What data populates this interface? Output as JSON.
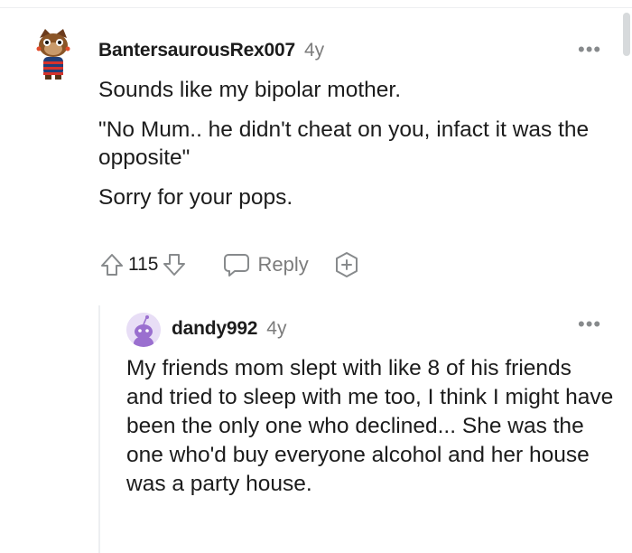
{
  "comment": {
    "username": "BantersaurousRex007",
    "age": "4y",
    "paragraphs": [
      "Sounds like my bipolar mother.",
      "\"No Mum.. he didn't cheat on you, infact it was the opposite\"",
      "Sorry for your pops."
    ],
    "score": "115",
    "reply_label": "Reply",
    "more_label": "•••"
  },
  "reply": {
    "username": "dandy992",
    "age": "4y",
    "body": "My friends mom slept with like 8 of his friends and tried to sleep with me too, I think I might have been the only one who declined... She was the one who'd buy everyone alcohol and her house was a party house.",
    "more_label": "•••"
  },
  "icons": [
    "upvote-icon",
    "downvote-icon",
    "reply-bubble-icon",
    "award-icon",
    "more-options-icon"
  ],
  "colors": {
    "text": "#1c1c1c",
    "muted": "#7c7c7c",
    "icon": "#878a8c",
    "thread_line": "#edeff1"
  }
}
